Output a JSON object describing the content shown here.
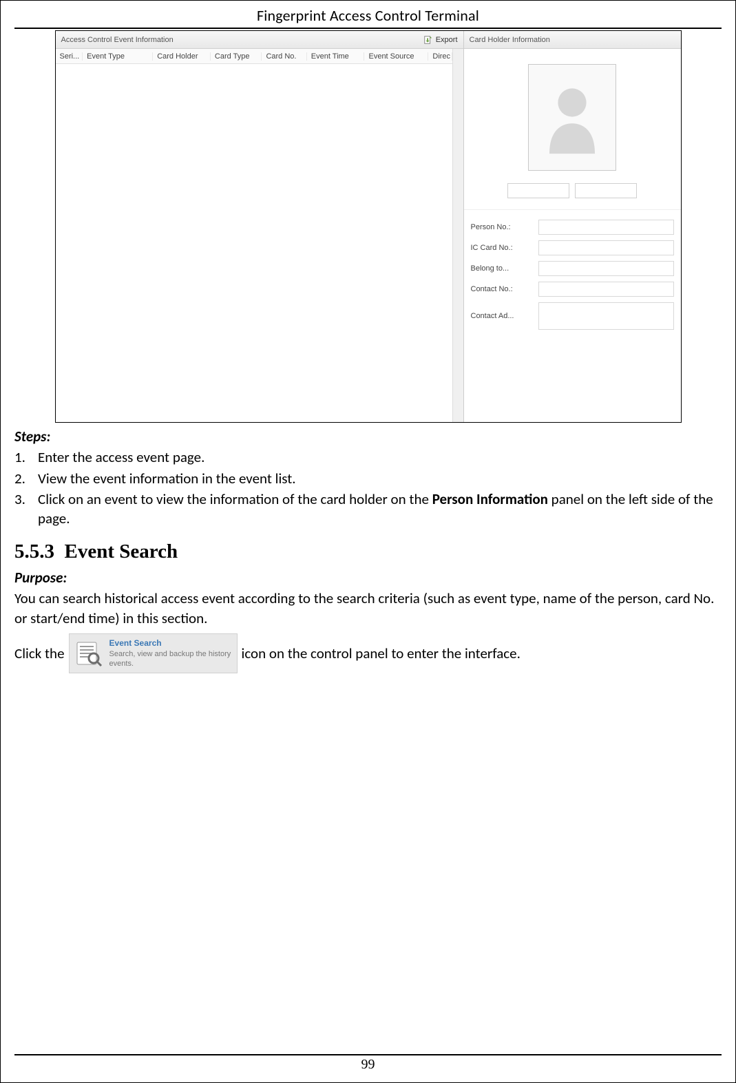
{
  "header": {
    "title": "Fingerprint Access Control Terminal"
  },
  "screenshot": {
    "left_panel_title": "Access Control Event Information",
    "export_label": "Export",
    "columns": {
      "serial": "Seri...",
      "event_type": "Event Type",
      "card_holder": "Card Holder",
      "card_type": "Card Type",
      "card_no": "Card No.",
      "event_time": "Event Time",
      "event_source": "Event Source",
      "direction": "Direc"
    },
    "right_panel_title": "Card Holder Information",
    "fields": {
      "person_no": "Person No.:",
      "ic_card_no": "IC Card No.:",
      "belong_to": "Belong to...",
      "contact_no": "Contact No.:",
      "contact_ad": "Contact Ad..."
    }
  },
  "steps": {
    "label": "Steps:",
    "items": [
      "Enter the access event page.",
      "View the event information in the event list."
    ],
    "item3_pre": "Click on an event to view the information of the card holder on the ",
    "item3_bold": "Person Information",
    "item3_post": " panel on the left side of the page."
  },
  "section": {
    "number": "5.5.3",
    "title": "Event Search"
  },
  "purpose": {
    "label": "Purpose:",
    "text": "You can search historical access event according to the search criteria (such as event type, name of the person, card No. or start/end time) in this section."
  },
  "click_line": {
    "pre": "Click the ",
    "post": " icon on the control panel to enter the interface."
  },
  "tile": {
    "title": "Event Search",
    "subtitle": "Search, view and backup the history events."
  },
  "page_number": "99"
}
